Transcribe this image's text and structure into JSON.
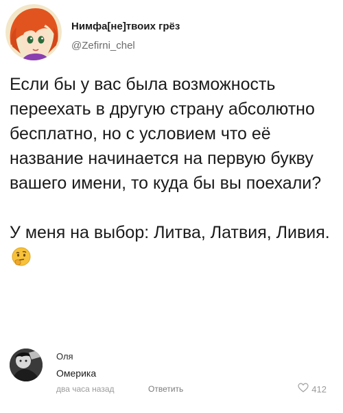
{
  "post": {
    "author_name": "Нимфа[не]твоих грёз",
    "author_handle": "@Zefirni_chel",
    "body_paragraph_1": "Если бы у вас была возможность переехать в другую страну абсолютно бесплатно, но с условием что её название начинается на первую букву вашего имени, то куда бы вы поехали?",
    "body_paragraph_2": "У меня на выбор: Литва, Латвия, Ливия."
  },
  "comment": {
    "author": "Оля",
    "text": "Омерика",
    "timestamp": "два часа назад",
    "reply_label": "Ответить",
    "like_count": "412"
  },
  "icons": {
    "post_avatar": "anime-avatar-icon",
    "emoji": "thinking-face-icon",
    "comment_avatar": "user-photo-avatar-icon",
    "like": "heart-outline-icon"
  }
}
